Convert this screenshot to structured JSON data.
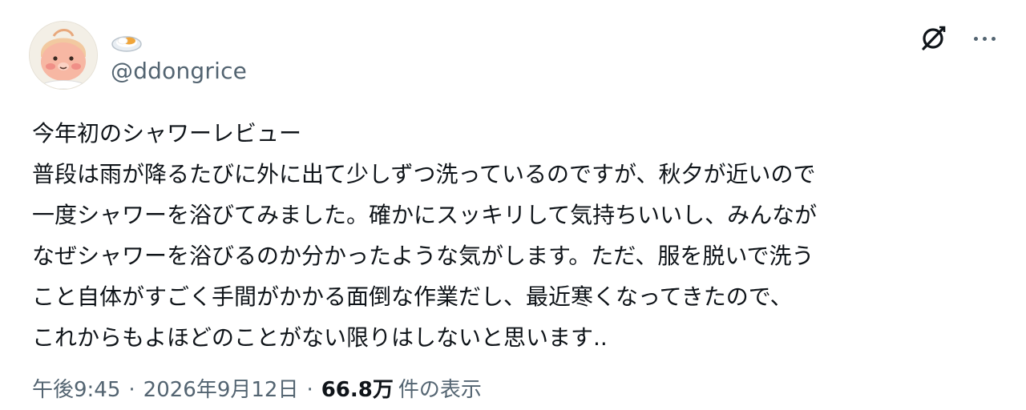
{
  "author": {
    "display_name_icon": "plate-of-food-emoji",
    "handle": "@ddongrice",
    "avatar_icon": "peach-character-avatar"
  },
  "actions": {
    "grok_icon": "grok-icon",
    "more_icon": "more-dots-icon"
  },
  "tweet": {
    "lines": [
      "今年初のシャワーレビュー",
      "普段は雨が降るたびに外に出て少しずつ洗っているのですが、秋夕が近いので",
      "一度シャワーを浴びてみました。確かにスッキリして気持ちいいし、みんなが",
      "なぜシャワーを浴びるのか分かったような気がします。ただ、服を脱いで洗う",
      "こと自体がすごく手間がかかる面倒な作業だし、最近寒くなってきたので、",
      "これからもよほどのことがない限りはしないと思います.."
    ]
  },
  "meta": {
    "time": "午後9:45",
    "separator": "·",
    "date": "2026年9月12日",
    "views_count": "66.8万",
    "views_label": "件の表示"
  },
  "colors": {
    "text_primary": "#0f1419",
    "text_secondary": "#536471",
    "background": "#ffffff"
  }
}
